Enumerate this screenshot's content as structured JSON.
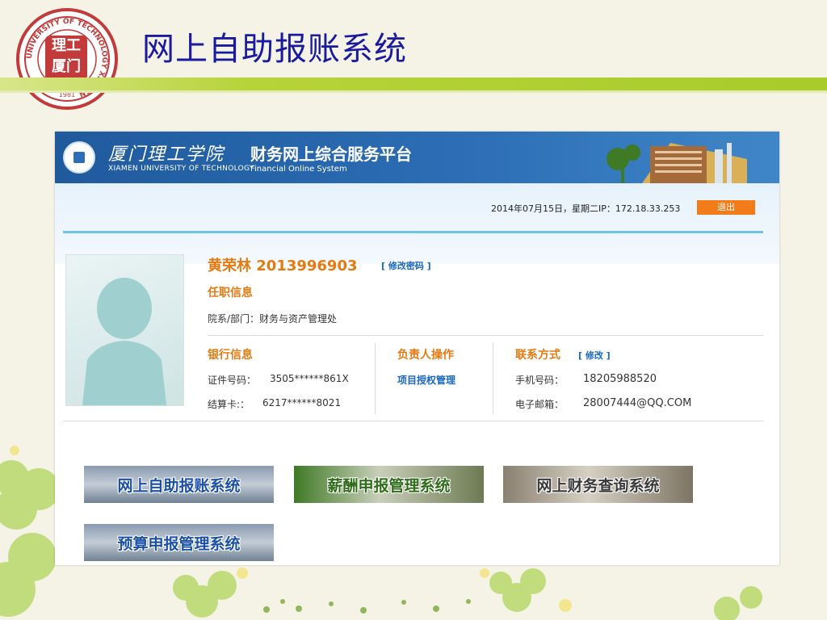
{
  "slide": {
    "title": "网上自助报账系统",
    "logo_ring_text": "UNIVERSITY OF TECHNOLOGY XIAMEN",
    "logo_year": "1981"
  },
  "app": {
    "header": {
      "school_cn": "厦门理工学院",
      "school_en": "XIAMEN UNIVERSITY OF TECHNOLOGY",
      "platform_cn": "财务网上综合服务平台",
      "platform_en": "Financial Online System"
    },
    "status": {
      "date_ip": "2014年07月15日，星期二IP：172.18.33.253",
      "logout_label": "退出"
    },
    "user": {
      "name_id": "黄荣林 2013996903",
      "change_password": "[ 修改密码 ]",
      "employment_label": "任职信息",
      "department": "院系/部门：财务与资产管理处"
    },
    "bank": {
      "label": "银行信息",
      "id_label": "证件号码：",
      "id_value": "3505******861X",
      "card_label": "结算卡:：",
      "card_value": "6217******8021"
    },
    "manager": {
      "label": "负责人操作",
      "auth_link": "项目授权管理"
    },
    "contact": {
      "label": "联系方式",
      "edit_link": "[ 修改 ]",
      "phone_label": "手机号码：",
      "phone_value": "18205988520",
      "email_label": "电子邮箱：",
      "email_value": "28007444@QQ.COM"
    },
    "systems": [
      {
        "label": "网上自助报账系统"
      },
      {
        "label": "薪酬申报管理系统"
      },
      {
        "label": "网上财务查询系统"
      },
      {
        "label": "预算申报管理系统"
      }
    ]
  },
  "colors": {
    "title_blue": "#1a1aa0",
    "accent_orange": "#e47a12",
    "link_blue": "#1a66c2",
    "logout_orange": "#f37c1a",
    "header_blue": "#2c6db5",
    "bar_green": "#a8cc2a"
  }
}
